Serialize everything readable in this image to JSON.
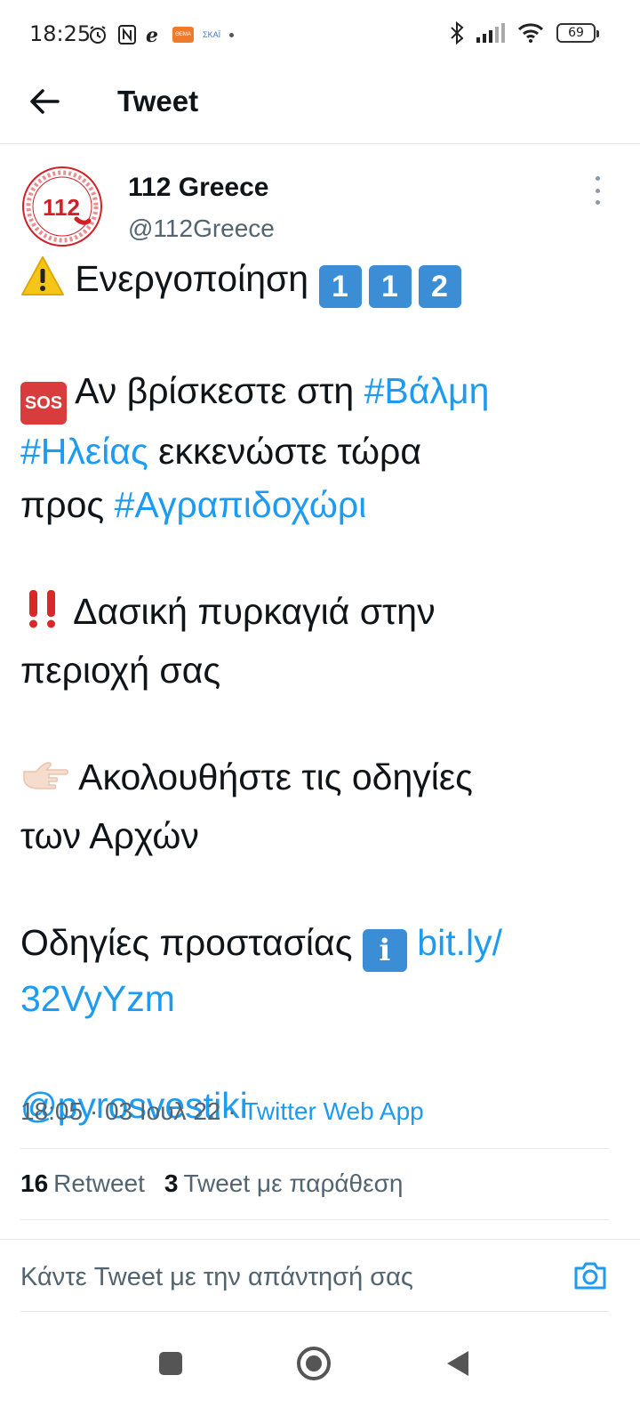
{
  "status_bar": {
    "time": "18:25",
    "battery": "69",
    "channel_text": "ΣΚΑΪ",
    "badge_text": "ΘΕΜΑ"
  },
  "header": {
    "title": "Tweet"
  },
  "tweet": {
    "author_name": "112 Greece",
    "author_handle": "@112Greece",
    "avatar_text": "112",
    "line1_text": "Ενεργοποίηση",
    "keycaps": [
      "1",
      "1",
      "2"
    ],
    "sos_badge": "SOS",
    "p2_text1": "Αν βρίσκεστε στη",
    "p2_hashtag1": "#Βάλμη",
    "p2_hashtag2": "#Ηλείας",
    "p2_text2": "εκκενώστε τώρα",
    "p2_text3": "προς",
    "p2_hashtag3": "#Αγραπιδοχώρι",
    "p3_text1": "Δασική πυρκαγιά στην",
    "p3_text2": "περιοχή σας",
    "p4_text1": "Ακολουθήστε τις οδηγίες",
    "p4_text2": "των Αρχών",
    "p5_text": "Οδηγίες προστασίας",
    "info_badge": "i",
    "p5_link1": "bit.ly/",
    "p5_link2": "32VyYzm",
    "mention": "@pyrosvestiki",
    "meta_time": "18:05 · 03 Ιουλ 22 · ",
    "meta_source": "Twitter Web App"
  },
  "stats": {
    "retweets_count": "16",
    "retweets_label": "Retweet",
    "quotes_count": "3",
    "quotes_label": "Tweet με παράθεση"
  },
  "reply": {
    "placeholder": "Κάντε Tweet με την απάντησή σας"
  },
  "colors": {
    "link": "#1d9bf0",
    "keycap": "#3b8ed6",
    "sos": "#d93c3c",
    "avatar_red": "#d32027"
  },
  "icons": {
    "back": "arrow-left-icon",
    "more": "more-vertical-icon",
    "camera": "camera-icon",
    "warning": "warning-icon",
    "double_exclamation": "double-exclamation-icon",
    "pointing_hand": "pointing-hand-icon"
  }
}
